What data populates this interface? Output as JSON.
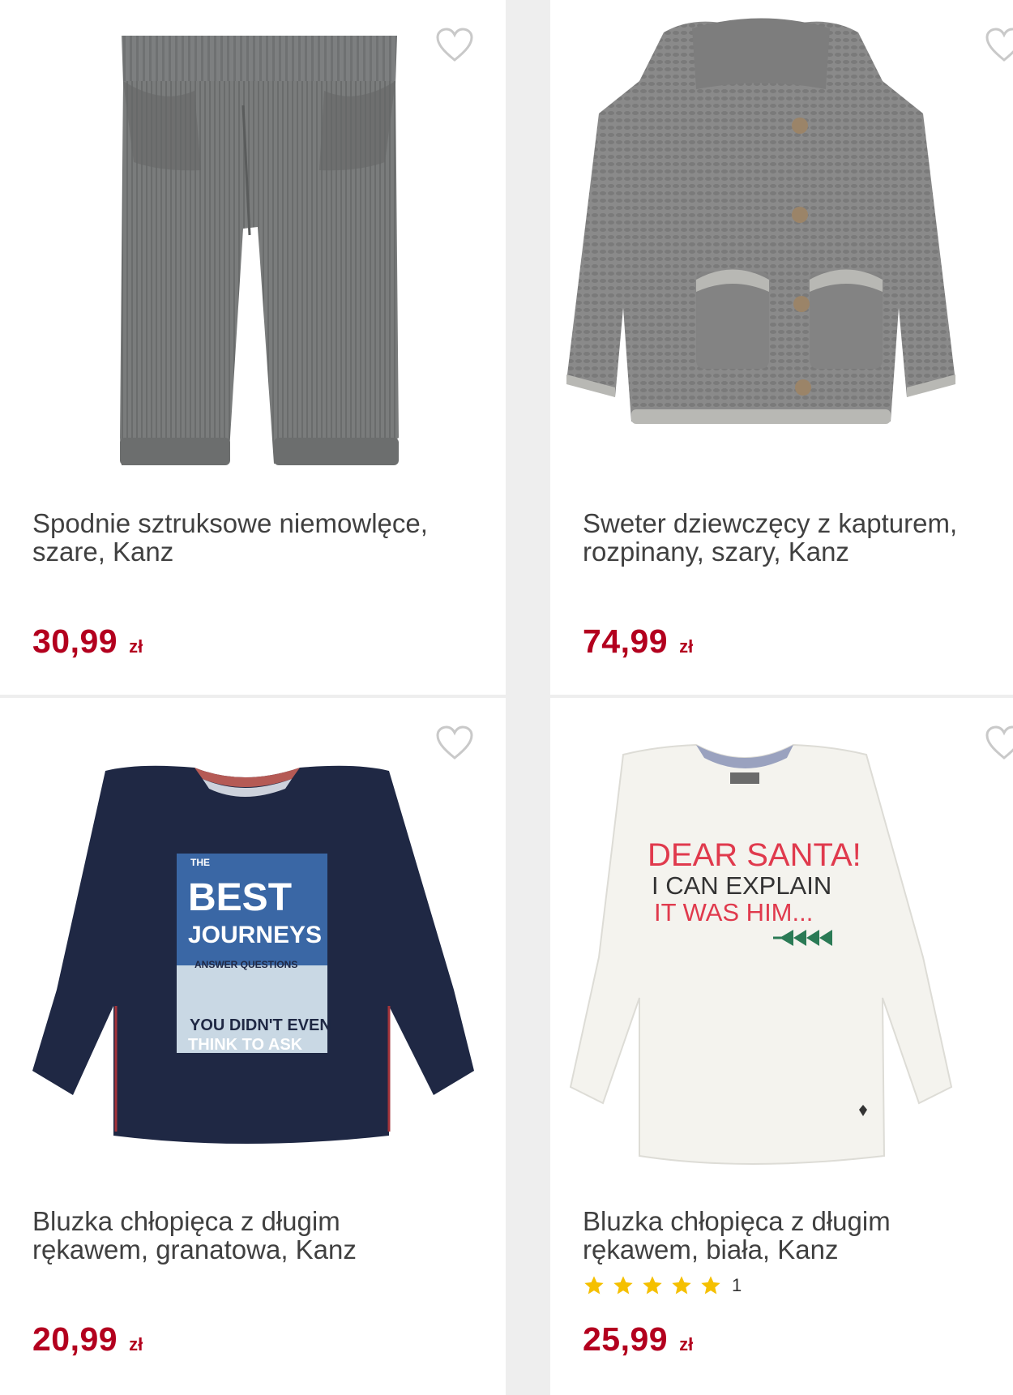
{
  "colors": {
    "price": "#b3001e",
    "star": "#f5c000",
    "background": "#eeeeee"
  },
  "products": [
    {
      "title": "Spodnie sztruksowe niemowlęce, szare, Kanz",
      "price": "30,99",
      "currency": "zł",
      "image_icon": "corduroy-pants-image",
      "wishlist_icon": "heart-outline-icon"
    },
    {
      "title": "Sweter dziewczęcy z kapturem, rozpinany, szary, Kanz",
      "price": "74,99",
      "currency": "zł",
      "image_icon": "hooded-cardigan-image",
      "wishlist_icon": "heart-outline-icon"
    },
    {
      "title": "Bluzka chłopięca z długim rękawem, granatowa, Kanz",
      "price": "20,99",
      "currency": "zł",
      "image_icon": "navy-longsleeve-image",
      "wishlist_icon": "heart-outline-icon",
      "print_text": [
        "THE",
        "BEST",
        "JOURNEYS",
        "ANSWER QUESTIONS",
        "YOU DIDN'T EVEN",
        "THINK TO ASK"
      ]
    },
    {
      "title": "Bluzka chłopięca z długim rękawem, biała, Kanz",
      "price": "25,99",
      "currency": "zł",
      "rating": {
        "stars": 5,
        "count": "1"
      },
      "image_icon": "white-longsleeve-image",
      "wishlist_icon": "heart-outline-icon",
      "print_text": [
        "DEAR SANTA!",
        "I CAN EXPLAIN",
        "IT WAS HIM..."
      ]
    }
  ]
}
